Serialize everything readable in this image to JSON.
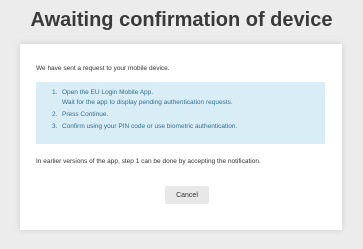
{
  "title": "Awaiting confirmation of device",
  "intro": "We have sent a request to your mobile device.",
  "steps": [
    {
      "number": "1.",
      "line1": "Open the EU Login Mobile App.",
      "line2": "Wait for the app to display pending authentication requests."
    },
    {
      "number": "2.",
      "line1": "Press Continue."
    },
    {
      "number": "3.",
      "line1": "Confirm using your PIN code or use biometric authentication."
    }
  ],
  "note": "In earlier versions of the app, step 1 can be done by accepting the notification.",
  "cancel_label": "Cancel",
  "colors": {
    "background": "#ececec",
    "card": "#ffffff",
    "info_box": "#d9edf7",
    "info_text": "#31708f",
    "button": "#e8e8e8"
  }
}
